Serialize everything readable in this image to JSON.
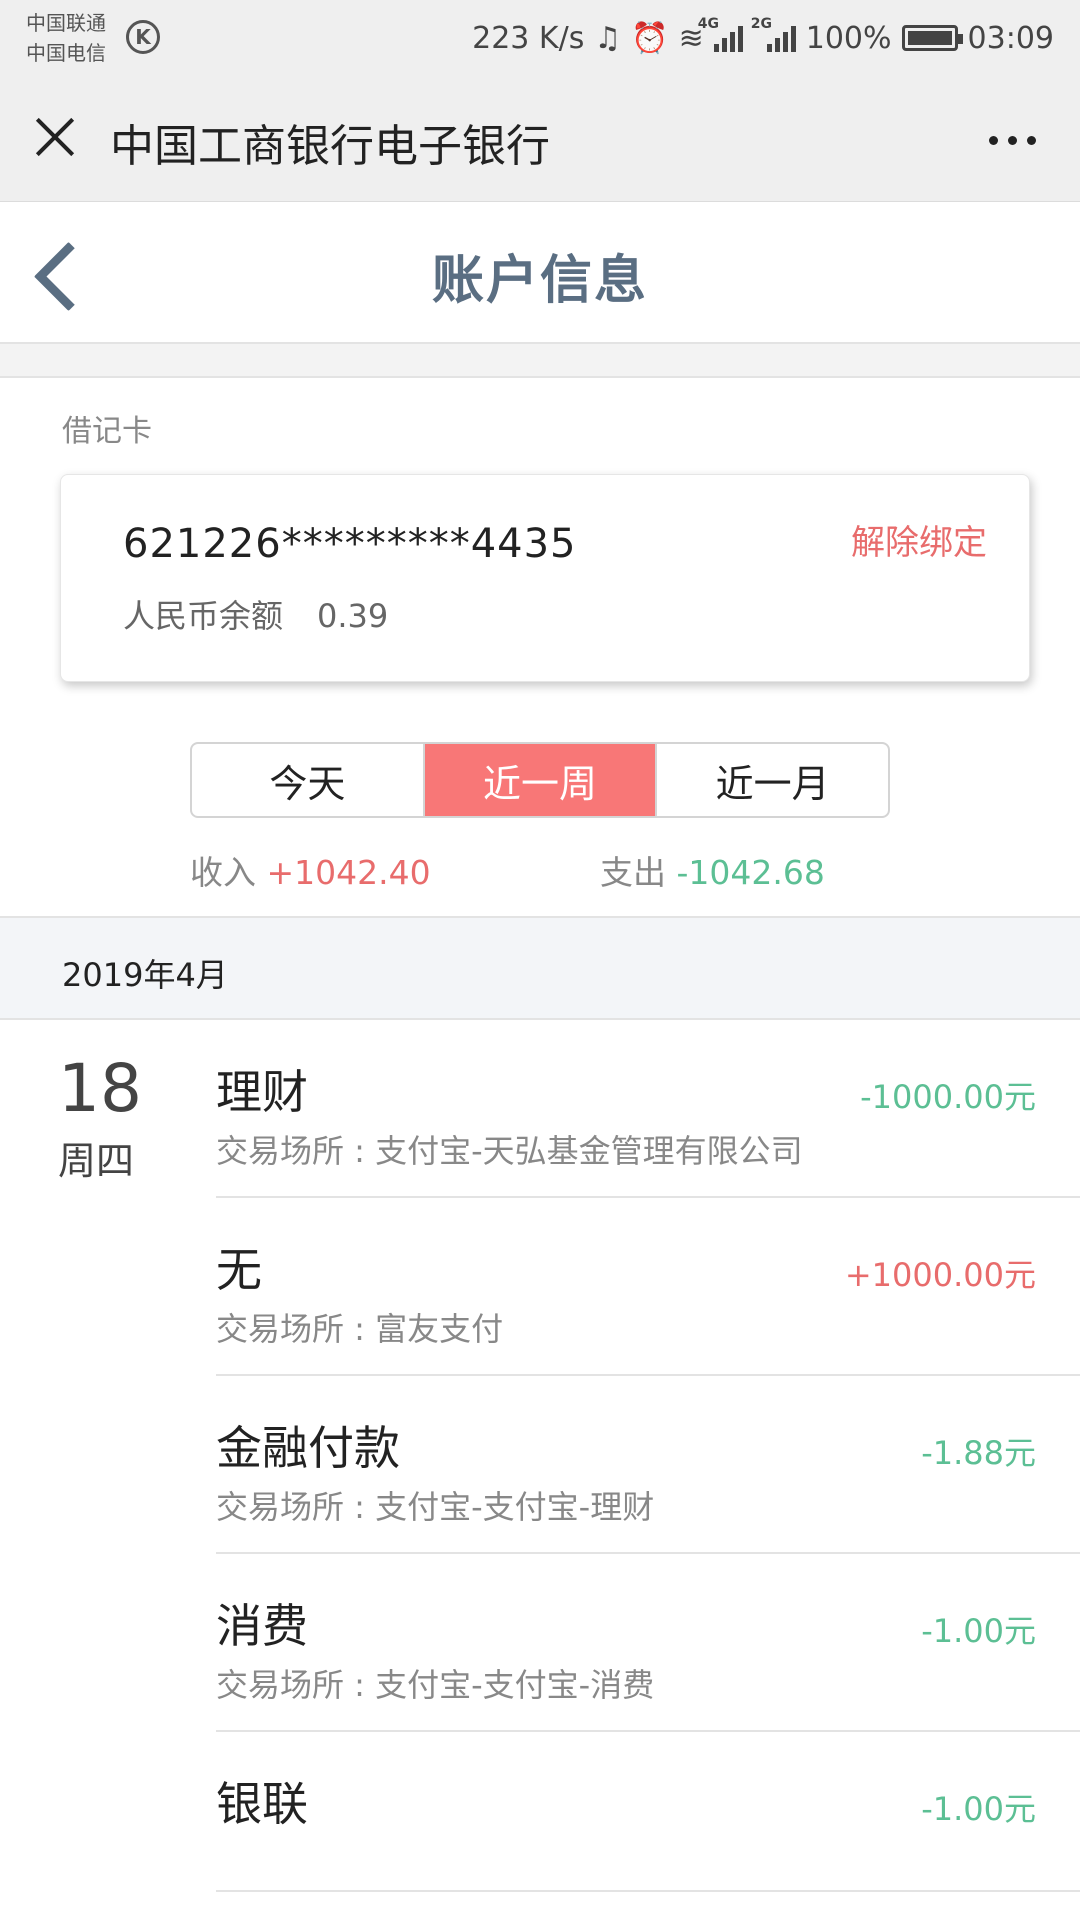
{
  "status_bar": {
    "carrier1": "中国联通",
    "carrier2": "中国电信",
    "k_badge": "K",
    "speed": "223 K/s",
    "net1": "4G",
    "net2": "2G",
    "battery": "100%",
    "time": "03:09"
  },
  "titlebar": {
    "title": "中国工商银行电子银行"
  },
  "page": {
    "title": "账户信息"
  },
  "card": {
    "type_label": "借记卡",
    "number": "621226*********4435",
    "unbind_label": "解除绑定",
    "balance_label": "人民币余额",
    "balance_value": "0.39"
  },
  "segment": {
    "items": [
      "今天",
      "近一周",
      "近一月"
    ],
    "active_index": 1
  },
  "totals": {
    "income_label": "收入",
    "income_value": "+1042.40",
    "expense_label": "支出",
    "expense_value": "-1042.68"
  },
  "month": "2019年4月",
  "date_group": {
    "day": "18",
    "weekday": "周四"
  },
  "transactions": [
    {
      "title": "理财",
      "amount": "-1000.00元",
      "place": "交易场所 : 支付宝-天弘基金管理有限公司",
      "kind": "neg"
    },
    {
      "title": "无",
      "amount": "+1000.00元",
      "place": "交易场所 : 富友支付",
      "kind": "pos"
    },
    {
      "title": "金融付款",
      "amount": "-1.88元",
      "place": "交易场所 : 支付宝-支付宝-理财",
      "kind": "neg"
    },
    {
      "title": "消费",
      "amount": "-1.00元",
      "place": "交易场所 : 支付宝-支付宝-消费",
      "kind": "neg"
    },
    {
      "title": "银联",
      "amount": "-1.00元",
      "place": "",
      "kind": "neg"
    }
  ],
  "colors": {
    "accent_red": "#f87777",
    "positive": "#e86c6c",
    "negative": "#5cbf94",
    "header_text": "#5a6e82"
  },
  "icons": {
    "close": "close-icon",
    "more": "more-icon",
    "back": "back-chevron-icon"
  }
}
